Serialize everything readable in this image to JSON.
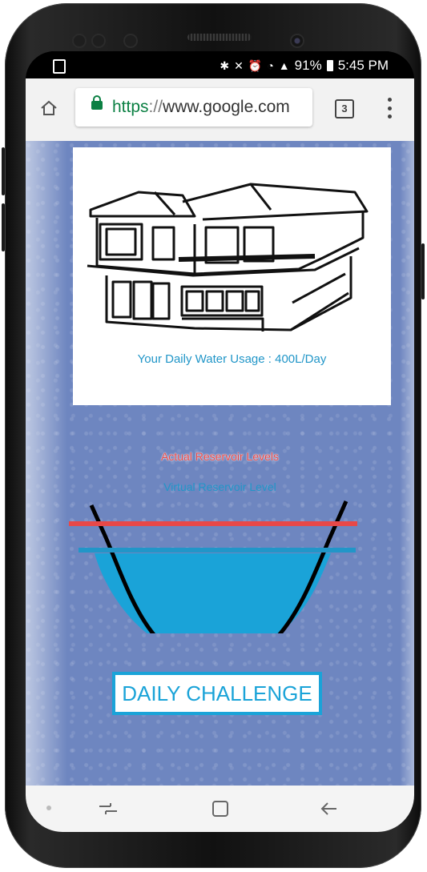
{
  "status_bar": {
    "battery": "91%",
    "time": "5:45 PM"
  },
  "browser": {
    "url_scheme": "https",
    "url_sep": "://",
    "url_host": "www.google.com",
    "tab_count": "3"
  },
  "page": {
    "usage_text": "Your Daily Water Usage : 400L/Day",
    "actual_label": "Actual Reservoir Levels",
    "virtual_label": "Virtual Reservoir Level",
    "challenge_button": "DAILY CHALLENGE"
  },
  "colors": {
    "background": "#6e86c0",
    "water": "#1aa3d8",
    "actual_line": "#e84848",
    "virtual_line": "#2196c8"
  }
}
